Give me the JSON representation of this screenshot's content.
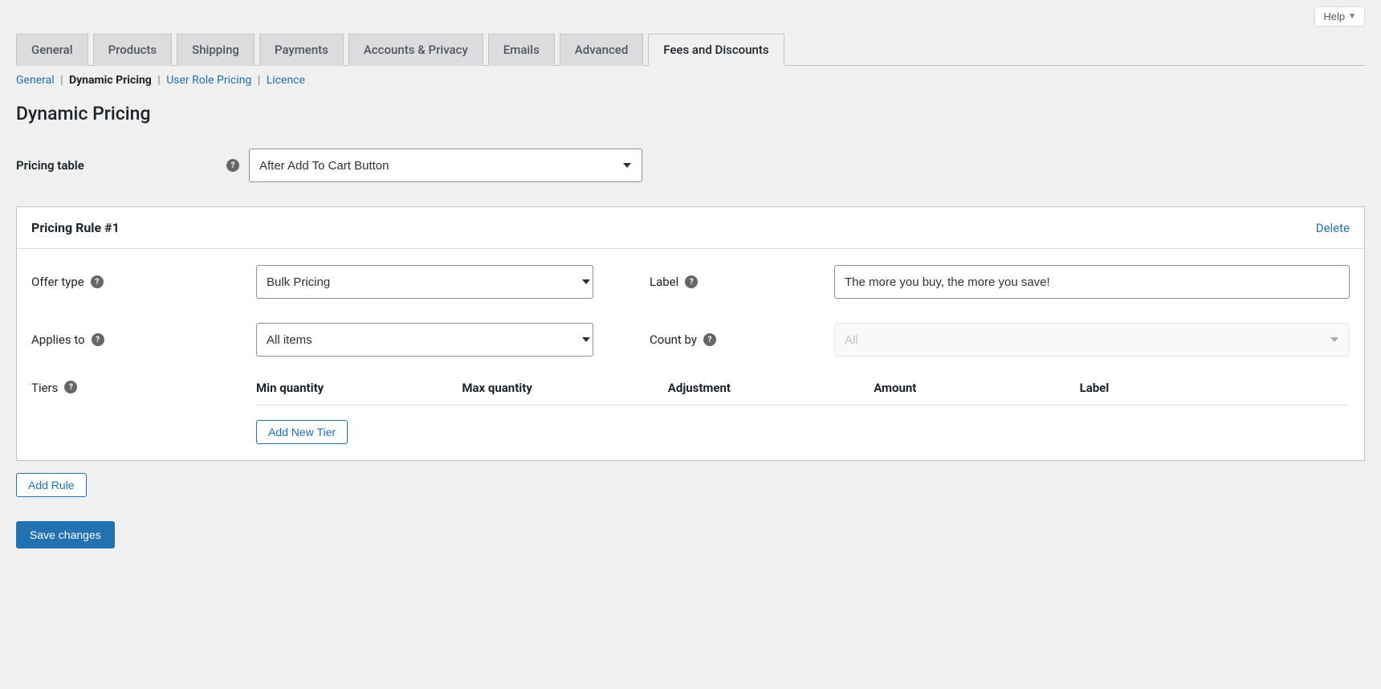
{
  "help_label": "Help",
  "tabs": {
    "general": "General",
    "products": "Products",
    "shipping": "Shipping",
    "payments": "Payments",
    "accounts": "Accounts & Privacy",
    "emails": "Emails",
    "advanced": "Advanced",
    "fees": "Fees and Discounts"
  },
  "subtabs": {
    "general": "General",
    "dynamic": "Dynamic Pricing",
    "userrole": "User Role Pricing",
    "licence": "Licence"
  },
  "page_title": "Dynamic Pricing",
  "pricing_table": {
    "label": "Pricing table",
    "value": "After Add To Cart Button"
  },
  "rule": {
    "title": "Pricing Rule #1",
    "delete": "Delete",
    "offer_type": {
      "label": "Offer type",
      "value": "Bulk Pricing"
    },
    "label_field": {
      "label": "Label",
      "value": "The more you buy, the more you save!"
    },
    "applies_to": {
      "label": "Applies to",
      "value": "All items"
    },
    "count_by": {
      "label": "Count by",
      "value": "All"
    },
    "tiers": {
      "label": "Tiers",
      "columns": {
        "min": "Min quantity",
        "max": "Max quantity",
        "adjustment": "Adjustment",
        "amount": "Amount",
        "label": "Label"
      },
      "add_tier": "Add New Tier"
    }
  },
  "add_rule": "Add Rule",
  "save": "Save changes"
}
